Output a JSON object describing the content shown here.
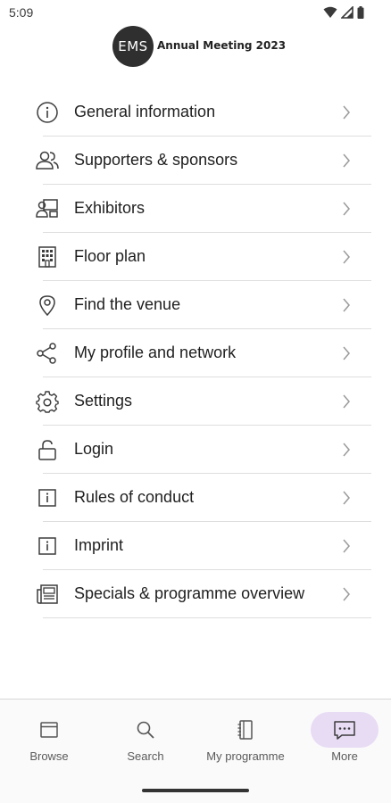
{
  "status_bar": {
    "time": "5:09",
    "icons": [
      "wifi-icon",
      "signal-icon",
      "battery-icon"
    ]
  },
  "header": {
    "logo_mark": "EMS",
    "title": "Annual Meeting 2023"
  },
  "menu": {
    "items": [
      {
        "label": "General information",
        "icon": "info-circle-icon"
      },
      {
        "label": "Supporters & sponsors",
        "icon": "people-icon"
      },
      {
        "label": "Exhibitors",
        "icon": "exhibitor-icon"
      },
      {
        "label": "Floor plan",
        "icon": "building-icon"
      },
      {
        "label": "Find the venue",
        "icon": "map-pin-icon"
      },
      {
        "label": "My profile and network",
        "icon": "network-icon"
      },
      {
        "label": "Settings",
        "icon": "gear-icon"
      },
      {
        "label": "Login",
        "icon": "unlock-icon"
      },
      {
        "label": "Rules of conduct",
        "icon": "info-square-icon"
      },
      {
        "label": "Imprint",
        "icon": "info-square-icon"
      },
      {
        "label": "Specials & programme overview",
        "icon": "newspaper-icon"
      }
    ]
  },
  "bottom_nav": {
    "items": [
      {
        "label": "Browse",
        "icon": "browser-window-icon",
        "active": false
      },
      {
        "label": "Search",
        "icon": "search-icon",
        "active": false
      },
      {
        "label": "My programme",
        "icon": "notebook-icon",
        "active": false
      },
      {
        "label": "More",
        "icon": "chat-dots-icon",
        "active": true
      }
    ]
  },
  "colors": {
    "active_nav_bg": "#e8dcf5",
    "icon_stroke": "#3c3c3c"
  }
}
